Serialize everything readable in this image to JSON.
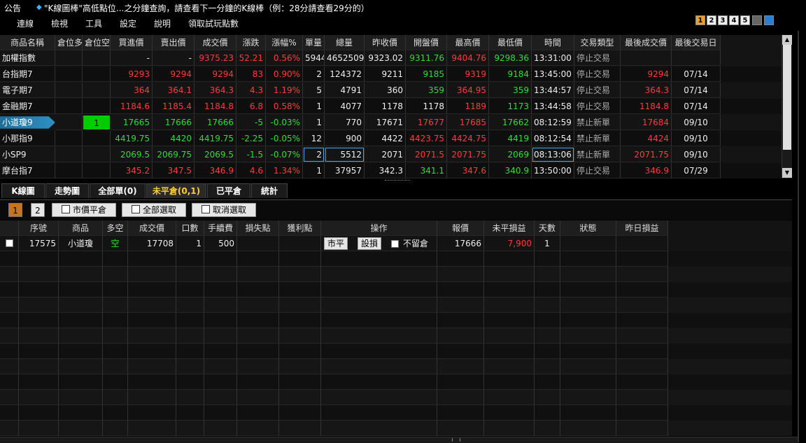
{
  "notice": {
    "label": "公告",
    "message": "\"K線圖棒\"高低點位...之分鐘查詢，請查看下一分鐘的K線棒（例：28分請查看29分的）"
  },
  "menu": [
    "連線",
    "檢視",
    "工具",
    "設定",
    "說明",
    "領取試玩點數"
  ],
  "layout_buttons": [
    "1",
    "2",
    "3",
    "4",
    "5"
  ],
  "quote_table": {
    "columns": [
      "商品名稱",
      "倉位多",
      "倉位空",
      "買進價",
      "賣出價",
      "成交價",
      "漲跌",
      "漲幅%",
      "單量",
      "總量",
      "昨收價",
      "開盤價",
      "最高價",
      "最低價",
      "時間",
      "交易類型",
      "最後成交價",
      "最後交易日"
    ],
    "rows": [
      [
        "加權指數",
        "",
        "",
        "-",
        "-",
        "9375.23",
        "52.21",
        "0.56%",
        "5944",
        "4652509",
        "9323.02",
        "9311.76",
        "9404.76",
        "9298.36",
        "13:31:00",
        "停止交易",
        "",
        ""
      ],
      [
        "台指期7",
        "",
        "",
        "9293",
        "9294",
        "9294",
        "83",
        "0.90%",
        "2",
        "124372",
        "9211",
        "9185",
        "9319",
        "9184",
        "13:45:00",
        "停止交易",
        "9294",
        "07/14"
      ],
      [
        "電子期7",
        "",
        "",
        "364",
        "364.1",
        "364.3",
        "4.3",
        "1.19%",
        "5",
        "4791",
        "360",
        "359",
        "364.95",
        "359",
        "13:44:57",
        "停止交易",
        "364.3",
        "07/14"
      ],
      [
        "金融期7",
        "",
        "",
        "1184.6",
        "1185.4",
        "1184.8",
        "6.8",
        "0.58%",
        "1",
        "4077",
        "1178",
        "1178",
        "1189",
        "1173",
        "13:44:58",
        "停止交易",
        "1184.8",
        "07/14"
      ],
      [
        "小道瓊9",
        "",
        "1",
        "17665",
        "17666",
        "17666",
        "-5",
        "-0.03%",
        "1",
        "770",
        "17671",
        "17677",
        "17685",
        "17662",
        "08:12:59",
        "禁止新單",
        "17684",
        "09/10"
      ],
      [
        "小那指9",
        "",
        "",
        "4419.75",
        "4420",
        "4419.75",
        "-2.25",
        "-0.05%",
        "12",
        "900",
        "4422",
        "4423.75",
        "4424.75",
        "4419",
        "08:12:54",
        "禁止新單",
        "4424",
        "09/10"
      ],
      [
        "小SP9",
        "",
        "",
        "2069.5",
        "2069.75",
        "2069.5",
        "-1.5",
        "-0.07%",
        "2",
        "5512",
        "2071",
        "2071.5",
        "2071.75",
        "2069",
        "08:13:06",
        "禁止新單",
        "2071.75",
        "09/10"
      ],
      [
        "摩台指7",
        "",
        "",
        "345.2",
        "347.5",
        "346.9",
        "4.6",
        "1.34%",
        "1",
        "37957",
        "342.3",
        "341.1",
        "347.6",
        "340.9",
        "13:50:00",
        "停止交易",
        "346.9",
        "07/29"
      ]
    ]
  },
  "tabs": [
    "K線圖",
    "走勢圖",
    "全部單(0)",
    "未平倉(0,1)",
    "已平倉",
    "統計"
  ],
  "active_tab": "未平倉(0,1)",
  "toolbar": {
    "pages": [
      "1",
      "2"
    ],
    "market_close_label": "市價平倉",
    "select_all_label": "全部選取",
    "deselect_label": "取消選取"
  },
  "positions_table": {
    "columns": [
      "序號",
      "商品",
      "多空",
      "成交價",
      "口數",
      "手續費",
      "損失點",
      "獲利點",
      "操作",
      "報價",
      "未平損益",
      "天數",
      "狀態",
      "昨日損益"
    ],
    "rows": [
      {
        "id": "17575",
        "product": "小道瓊",
        "side": "空",
        "price": "17708",
        "lots": "1",
        "fee": "500",
        "stop_loss": "",
        "take_profit": "",
        "btn_close": "市平",
        "btn_set": "設損",
        "no_overnight": "不留倉",
        "quote": "17666",
        "unrealized": "7,900",
        "days": "1",
        "status": "",
        "yesterday_pnl": ""
      }
    ]
  },
  "colors": {
    "up": "#ff3b3b",
    "down": "#33dd33",
    "accent_tab": "#ffcc33",
    "highlight_cell": "#00cc00"
  }
}
